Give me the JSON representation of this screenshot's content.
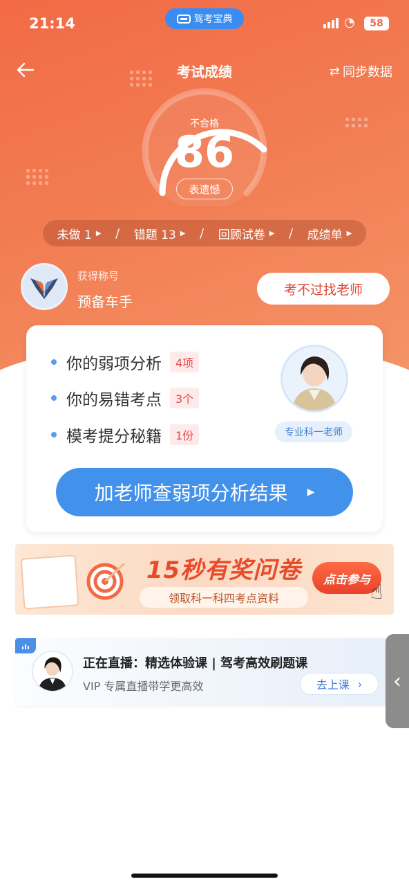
{
  "status_bar": {
    "time": "21:14",
    "app_name": "驾考宝典",
    "battery": "58"
  },
  "nav": {
    "title": "考试成绩",
    "sync_label": "同步数据"
  },
  "result": {
    "status": "不合格",
    "score": "86",
    "remark": "表遗憾"
  },
  "tabs": [
    {
      "label": "未做 1"
    },
    {
      "label": "错题  13"
    },
    {
      "label": "回顾试卷"
    },
    {
      "label": "成绩单"
    }
  ],
  "award": {
    "caption": "获得称号",
    "name": "预备车手"
  },
  "teacher_button": "考不过找老师",
  "analysis": {
    "items": [
      {
        "text": "你的弱项分析",
        "count": "4项"
      },
      {
        "text": "你的易错考点",
        "count": "3个"
      },
      {
        "text": "模考提分秘籍",
        "count": "1份"
      }
    ],
    "teacher_tag": "专业科一老师",
    "cta": "加老师查弱项分析结果"
  },
  "banner": {
    "title": "15秒有奖问卷",
    "subtitle": "领取科一科四考点资料",
    "button": "点击参与"
  },
  "live": {
    "title": "正在直播：精选体验课 | 驾考高效刷题课",
    "subtitle": "VIP 专属直播带学更高效",
    "button": "去上课"
  },
  "colors": {
    "accent_orange": "#f26a45",
    "accent_blue": "#4292ec",
    "count_red": "#e54b45"
  }
}
